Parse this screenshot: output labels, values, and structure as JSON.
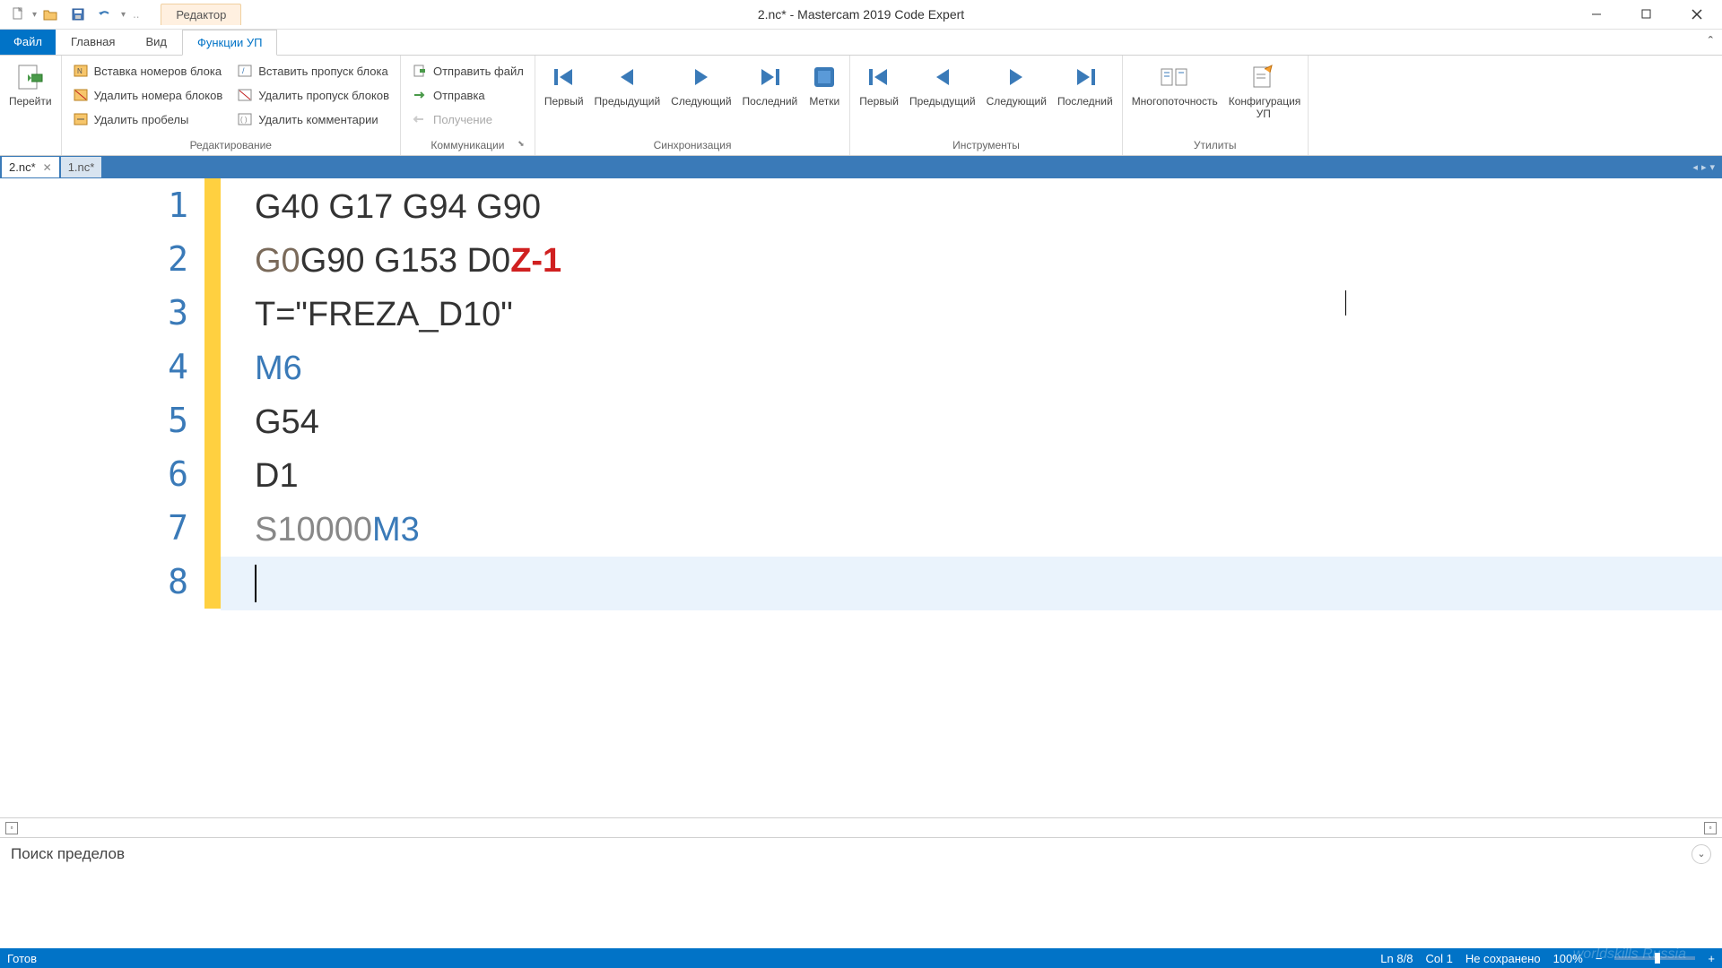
{
  "window": {
    "title": "2.nc* - Mastercam 2019 Code Expert",
    "app_label": "Редактор"
  },
  "menu": {
    "file": "Файл",
    "tabs": [
      "Главная",
      "Вид",
      "Функции УП"
    ],
    "active_index": 2
  },
  "ribbon": {
    "goto": {
      "label": "Перейти"
    },
    "editing": {
      "label": "Редактирование",
      "items": [
        "Вставка номеров блока",
        "Удалить номера блоков",
        "Удалить пробелы",
        "Вставить пропуск блока",
        "Удалить пропуск блоков",
        "Удалить комментарии"
      ]
    },
    "comms": {
      "label": "Коммуникации",
      "items": [
        "Отправить файл",
        "Отправка",
        "Получение"
      ]
    },
    "sync": {
      "label": "Синхронизация",
      "items": [
        "Первый",
        "Предыдущий",
        "Следующий",
        "Последний",
        "Метки"
      ]
    },
    "tools": {
      "label": "Инструменты",
      "items": [
        "Первый",
        "Предыдущий",
        "Следующий",
        "Последний"
      ]
    },
    "utils": {
      "label": "Утилиты",
      "items": [
        "Многопоточность",
        "Конфигурация УП"
      ]
    }
  },
  "tabs": {
    "items": [
      "2.nc*",
      "1.nc*"
    ],
    "active_index": 0
  },
  "editor": {
    "lines": [
      {
        "n": 1,
        "tokens": [
          {
            "t": "G40 G17 G94 G90",
            "c": "default"
          }
        ]
      },
      {
        "n": 2,
        "tokens": [
          {
            "t": "G0",
            "c": "cmd"
          },
          {
            "t": " ",
            "c": "default"
          },
          {
            "t": "G90 G153 D0",
            "c": "default"
          },
          {
            "t": " ",
            "c": "default"
          },
          {
            "t": "Z-1",
            "c": "red"
          }
        ]
      },
      {
        "n": 3,
        "tokens": [
          {
            "t": "T=\"FREZA_D10\"",
            "c": "default"
          }
        ]
      },
      {
        "n": 4,
        "tokens": [
          {
            "t": "M6",
            "c": "blue"
          }
        ]
      },
      {
        "n": 5,
        "tokens": [
          {
            "t": "G54",
            "c": "default"
          }
        ]
      },
      {
        "n": 6,
        "tokens": [
          {
            "t": "D1",
            "c": "default"
          }
        ]
      },
      {
        "n": 7,
        "tokens": [
          {
            "t": "S10000",
            "c": "spindle"
          },
          {
            "t": " ",
            "c": "default"
          },
          {
            "t": "M3",
            "c": "blue"
          }
        ]
      },
      {
        "n": 8,
        "tokens": [],
        "current": true
      }
    ]
  },
  "search": {
    "label": "Поиск пределов"
  },
  "status": {
    "ready": "Готов",
    "line": "Ln 8/8",
    "col": "Col 1",
    "saved": "Не сохранено",
    "zoom": "100%"
  }
}
